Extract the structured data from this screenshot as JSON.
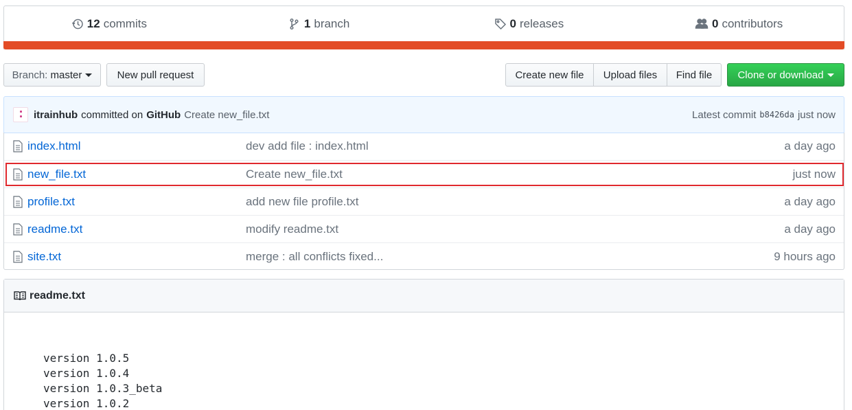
{
  "stats": {
    "commits": {
      "count": "12",
      "label": "commits",
      "icon": "history-icon"
    },
    "branches": {
      "count": "1",
      "label": "branch",
      "icon": "git-branch-icon"
    },
    "releases": {
      "count": "0",
      "label": "releases",
      "icon": "tag-icon"
    },
    "contributors": {
      "count": "0",
      "label": "contributors",
      "icon": "people-icon"
    },
    "language_bar_color": "#e34c26"
  },
  "toolbar": {
    "branch_prefix": "Branch:",
    "branch_name": "master",
    "new_pull_request": "New pull request",
    "create_new_file": "Create new file",
    "upload_files": "Upload files",
    "find_file": "Find file",
    "clone_or_download": "Clone or download"
  },
  "latest_commit": {
    "author": "itrainhub",
    "committed_on": "committed on",
    "committer": "GitHub",
    "message": "Create new_file.txt",
    "label": "Latest commit",
    "sha": "b8426da",
    "time": "just now"
  },
  "files": [
    {
      "name": "index.html",
      "message": "dev add file : index.html",
      "age": "a day ago"
    },
    {
      "name": "new_file.txt",
      "message": "Create new_file.txt",
      "age": "just now"
    },
    {
      "name": "profile.txt",
      "message": "add new file profile.txt",
      "age": "a day ago"
    },
    {
      "name": "readme.txt",
      "message": "modify readme.txt",
      "age": "a day ago"
    },
    {
      "name": "site.txt",
      "message": "merge : all conflicts fixed...",
      "age": "9 hours ago"
    }
  ],
  "readme": {
    "title": "readme.txt",
    "content": "version 1.0.5\nversion 1.0.4\nversion 1.0.3_beta\nversion 1.0.2"
  },
  "colors": {
    "link": "#0366d6",
    "highlight_border": "#e0292e",
    "clone_button": "#28a745"
  }
}
